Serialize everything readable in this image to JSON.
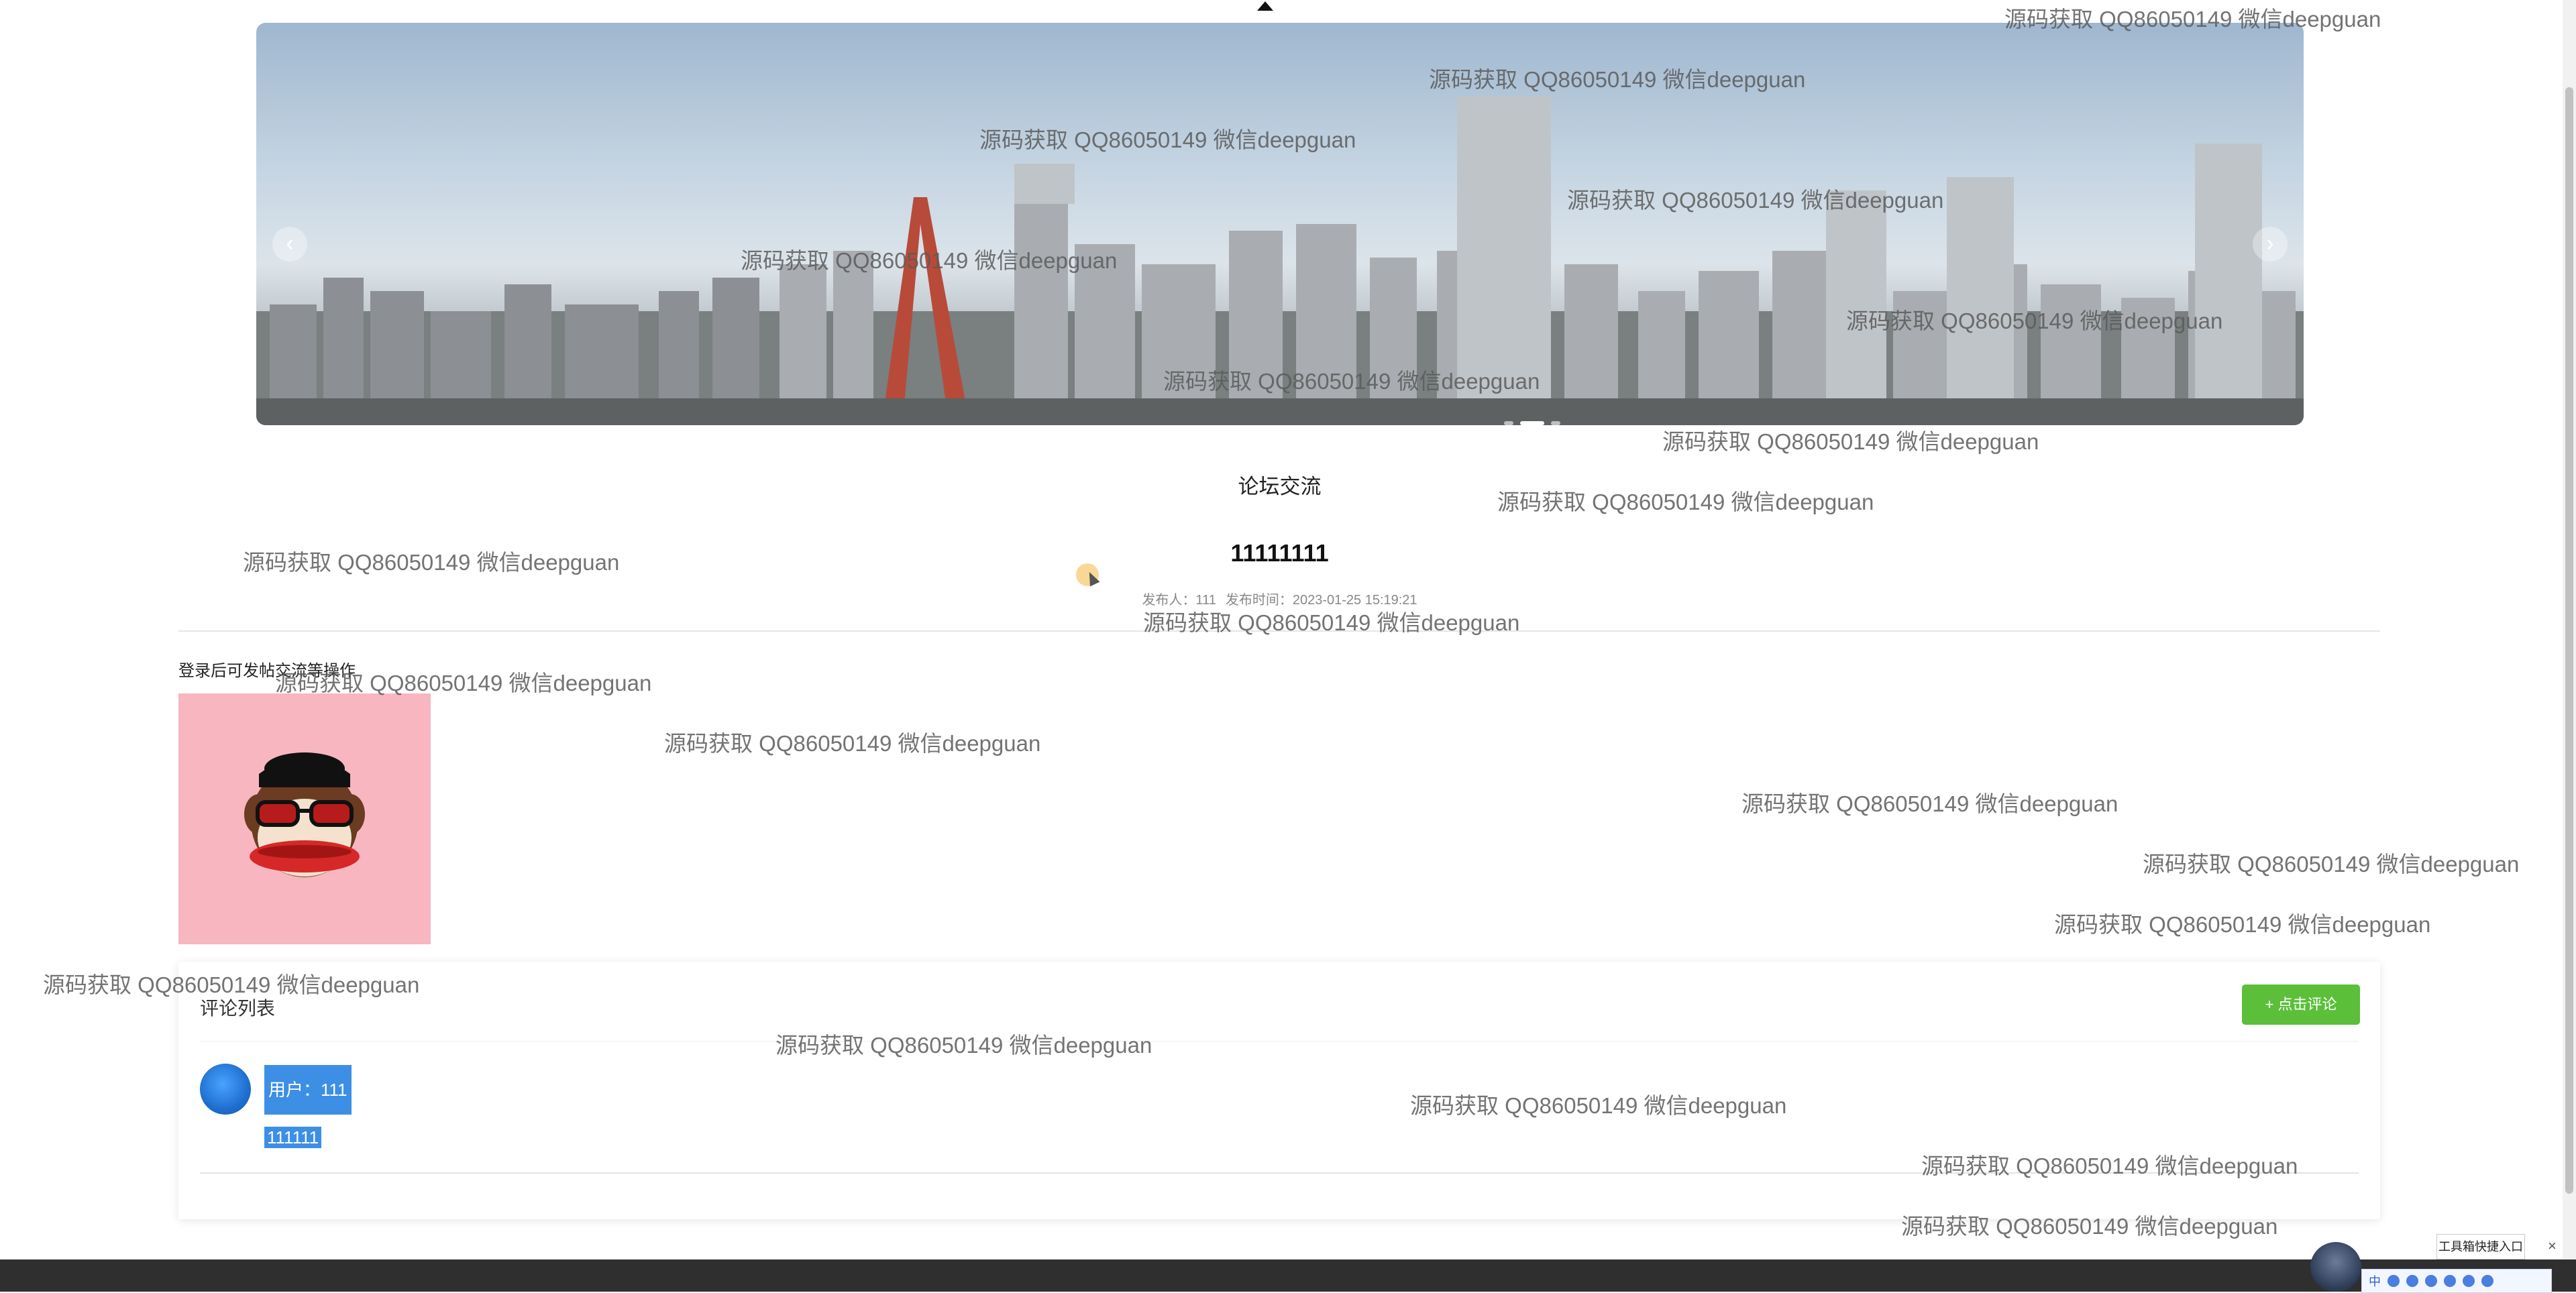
{
  "banner": {
    "prev_label": "‹",
    "next_label": "›",
    "slide_count": 3,
    "active_slide": 2
  },
  "section": {
    "title": "论坛交流"
  },
  "post": {
    "title": "11111111",
    "author_label": "发布人：111",
    "time_label": "发布时间：2023-01-25 15:19:21"
  },
  "login_hint": "登录后可发帖交流等操作",
  "comments": {
    "header": "评论列表",
    "add_button": "+ 点击评论",
    "items": [
      {
        "user": "用户：111",
        "text": "111111"
      }
    ]
  },
  "toolbox": {
    "label": "工具箱快捷入口",
    "close": "×",
    "lang": "中"
  },
  "watermark_text": "源码获取 QQ86050149 微信deepguan",
  "colors": {
    "accent_green": "#5bbf3a",
    "selection_blue": "#3d8fe6",
    "footer": "#2f2f2f"
  }
}
